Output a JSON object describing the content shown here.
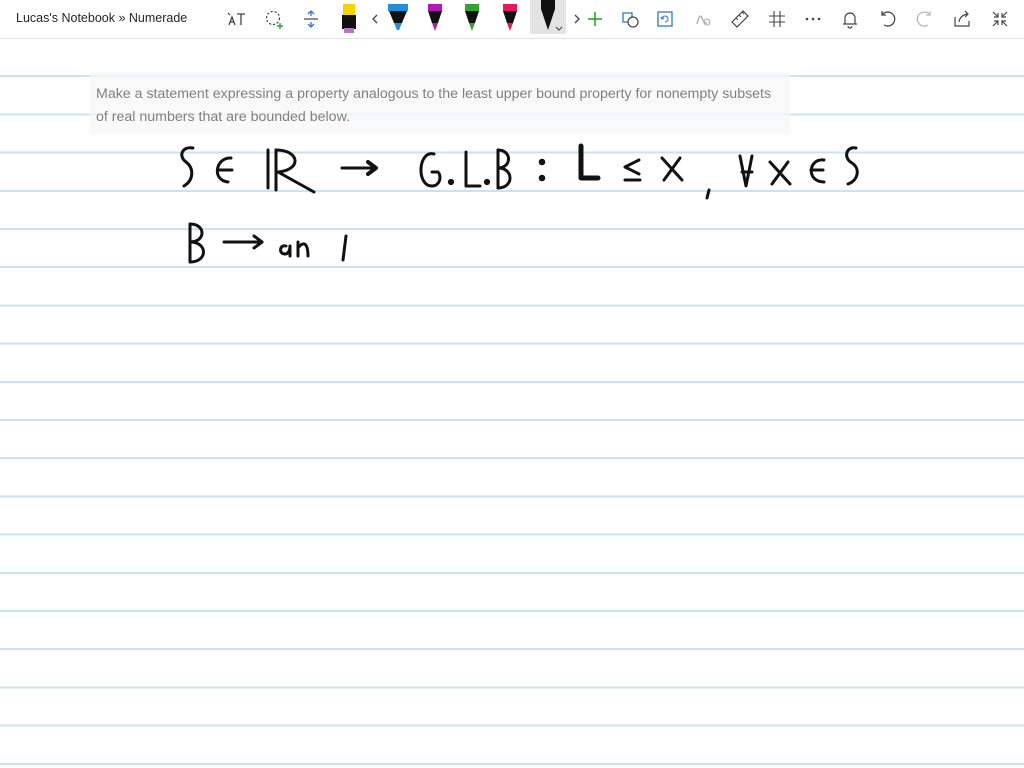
{
  "window": {
    "title": "Lucas's Notebook » Numerade"
  },
  "toolbar": {
    "tools": [
      {
        "name": "ink-to-text-icon"
      },
      {
        "name": "lasso-select-icon"
      },
      {
        "name": "add-space-icon"
      },
      {
        "name": "pen-yellow",
        "color": "#f5d400"
      },
      {
        "name": "scroll-left-icon"
      },
      {
        "name": "pen-blue",
        "color": "#1e90d8"
      },
      {
        "name": "pen-purple",
        "color": "#b517b5"
      },
      {
        "name": "pen-green",
        "color": "#2ea52e"
      },
      {
        "name": "pen-red",
        "color": "#e8185c"
      },
      {
        "name": "pen-black",
        "color": "#111111"
      },
      {
        "name": "scroll-right-icon"
      },
      {
        "name": "add-pen-icon"
      },
      {
        "name": "ink-to-shape-icon"
      },
      {
        "name": "replay-icon"
      },
      {
        "name": "ink-to-math-icon"
      },
      {
        "name": "ruler-icon"
      },
      {
        "name": "snap-icon"
      },
      {
        "name": "more-icon"
      },
      {
        "name": "bell-icon"
      },
      {
        "name": "undo-icon"
      },
      {
        "name": "redo-icon"
      },
      {
        "name": "share-icon"
      },
      {
        "name": "exit-fullscreen-icon"
      }
    ],
    "add_pen_color": "#1aa31a",
    "accent": "#2b78d4"
  },
  "question": {
    "text": "Make a statement expressing a property analogous to the least upper bound property for nonempty subsets of real numbers that are bounded below."
  },
  "colors": {
    "rule_line": "#c9e4f1",
    "ink": "#111111"
  }
}
